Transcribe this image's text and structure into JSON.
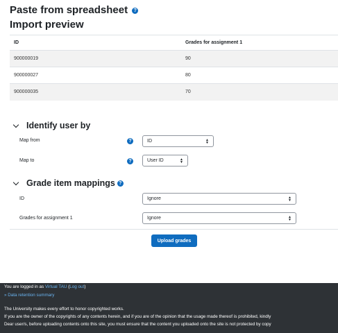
{
  "header": {
    "paste_title": "Paste from spreadsheet",
    "import_title": "Import preview"
  },
  "preview": {
    "columns": [
      "ID",
      "Grades for assignment 1"
    ],
    "rows": [
      [
        "900000019",
        "90"
      ],
      [
        "900000027",
        "80"
      ],
      [
        "900000035",
        "70"
      ]
    ]
  },
  "identify": {
    "heading": "Identify user by",
    "map_from_label": "Map from",
    "map_from_value": "ID",
    "map_to_label": "Map to",
    "map_to_value": "User ID"
  },
  "mappings": {
    "heading": "Grade item mappings",
    "id_label": "ID",
    "id_value": "Ignore",
    "grades_label": "Grades for assignment 1",
    "grades_value": "Ignore"
  },
  "actions": {
    "upload_label": "Upload grades"
  },
  "footer": {
    "logged_in_prefix": "You are logged in as",
    "user_name": "Virtual TAU",
    "logout_open": "(",
    "logout_label": "Log out",
    "logout_close": ")",
    "data_retention": "» Data retention summary",
    "line1": "The University makes every effort to honor copyrighted works.",
    "line2": "If you are the owner of the copyrights of any contents herein, and if you are of the opinion that the usage made thereof is prohibited, kindly",
    "line3": "Dear user/s, before uploading contents onto this site, you must ensure that the content you uploaded onto the site is not protected by copy"
  },
  "icons": {
    "help": "question-circle-icon",
    "collapse": "chevron-down-icon",
    "select": "sort-arrows-icon"
  },
  "colors": {
    "accent": "#0f6cbf",
    "footer_bg": "#2e3236",
    "link": "#6ab3ef"
  }
}
